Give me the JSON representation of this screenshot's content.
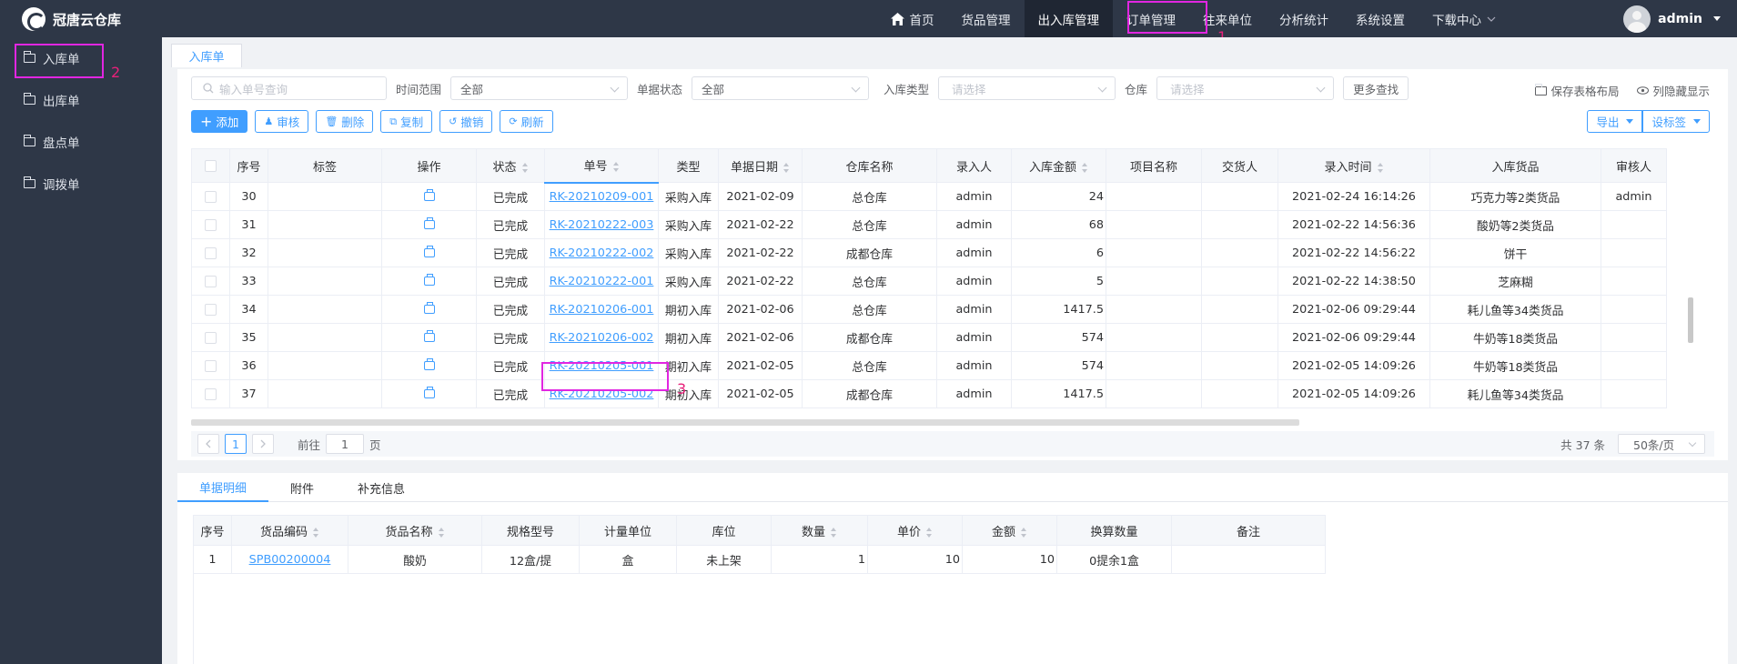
{
  "app": {
    "name": "冠唐云仓库"
  },
  "nav": {
    "items": [
      {
        "label": "首页"
      },
      {
        "label": "货品管理"
      },
      {
        "label": "出入库管理"
      },
      {
        "label": "订单管理"
      },
      {
        "label": "往来单位"
      },
      {
        "label": "分析统计"
      },
      {
        "label": "系统设置"
      },
      {
        "label": "下载中心"
      }
    ],
    "active": "出入库管理",
    "user": "admin"
  },
  "annotations": {
    "n1": "1",
    "n2": "2",
    "n3": "3",
    "color": "#e126e1"
  },
  "sidebar": {
    "items": [
      {
        "label": "入库单"
      },
      {
        "label": "出库单"
      },
      {
        "label": "盘点单"
      },
      {
        "label": "调拨单"
      }
    ]
  },
  "page_tab": "入库单",
  "filters": {
    "search_placeholder": "输入单号查询",
    "time_label": "时间范围",
    "time_value": "全部",
    "status_label": "单据状态",
    "status_value": "全部",
    "type_label": "入库类型",
    "type_placeholder": "请选择",
    "warehouse_label": "仓库",
    "warehouse_placeholder": "请选择",
    "more": "更多查找",
    "save_layout": "保存表格布局",
    "column_toggle": "列隐藏显示"
  },
  "toolbar": {
    "add": "添加",
    "audit": "审核",
    "delete": "删除",
    "copy": "复制",
    "revoke": "撤销",
    "refresh": "刷新",
    "export": "导出",
    "settings": "设标签"
  },
  "table": {
    "headers": [
      "序号",
      "标签",
      "操作",
      "状态",
      "单号",
      "类型",
      "单据日期",
      "仓库名称",
      "录入人",
      "入库金额",
      "项目名称",
      "交货人",
      "录入时间",
      "入库货品",
      "审核人"
    ],
    "rows": [
      {
        "no": "30",
        "status": "已完成",
        "code": "RK-20210209-001",
        "type": "采购入库",
        "date": "2021-02-09",
        "warehouse": "总仓库",
        "operator": "admin",
        "amount": "24",
        "time": "2021-02-24 16:14:26",
        "goods": "巧克力等2类货品",
        "auditor": "admin"
      },
      {
        "no": "31",
        "status": "已完成",
        "code": "RK-20210222-003",
        "type": "采购入库",
        "date": "2021-02-22",
        "warehouse": "总仓库",
        "operator": "admin",
        "amount": "68",
        "time": "2021-02-22 14:56:36",
        "goods": "酸奶等2类货品",
        "auditor": ""
      },
      {
        "no": "32",
        "status": "已完成",
        "code": "RK-20210222-002",
        "type": "采购入库",
        "date": "2021-02-22",
        "warehouse": "成都仓库",
        "operator": "admin",
        "amount": "6",
        "time": "2021-02-22 14:56:22",
        "goods": "饼干",
        "auditor": ""
      },
      {
        "no": "33",
        "status": "已完成",
        "code": "RK-20210222-001",
        "type": "采购入库",
        "date": "2021-02-22",
        "warehouse": "总仓库",
        "operator": "admin",
        "amount": "5",
        "time": "2021-02-22 14:38:50",
        "goods": "芝麻糊",
        "auditor": ""
      },
      {
        "no": "34",
        "status": "已完成",
        "code": "RK-20210206-001",
        "type": "期初入库",
        "date": "2021-02-06",
        "warehouse": "总仓库",
        "operator": "admin",
        "amount": "1417.5",
        "time": "2021-02-06 09:29:44",
        "goods": "耗儿鱼等34类货品",
        "auditor": ""
      },
      {
        "no": "35",
        "status": "已完成",
        "code": "RK-20210206-002",
        "type": "期初入库",
        "date": "2021-02-06",
        "warehouse": "成都仓库",
        "operator": "admin",
        "amount": "574",
        "time": "2021-02-06 09:29:44",
        "goods": "牛奶等18类货品",
        "auditor": ""
      },
      {
        "no": "36",
        "status": "已完成",
        "code": "RK-20210205-001",
        "type": "期初入库",
        "date": "2021-02-05",
        "warehouse": "总仓库",
        "operator": "admin",
        "amount": "574",
        "time": "2021-02-05 14:09:26",
        "goods": "牛奶等18类货品",
        "auditor": ""
      },
      {
        "no": "37",
        "status": "已完成",
        "code": "RK-20210205-002",
        "type": "期初入库",
        "date": "2021-02-05",
        "warehouse": "成都仓库",
        "operator": "admin",
        "amount": "1417.5",
        "time": "2021-02-05 14:09:26",
        "goods": "耗儿鱼等34类货品",
        "auditor": ""
      }
    ]
  },
  "pager": {
    "goto_prefix": "前往",
    "goto_value": "1",
    "goto_suffix": "页",
    "current": "1",
    "total": "共 37 条",
    "page_size": "50条/页"
  },
  "detail": {
    "tabs": [
      "单据明细",
      "附件",
      "补充信息"
    ],
    "headers": [
      "序号",
      "货品编码",
      "货品名称",
      "规格型号",
      "计量单位",
      "库位",
      "数量",
      "单价",
      "金额",
      "换算数量",
      "备注"
    ],
    "rows": [
      {
        "no": "1",
        "code": "SPB00200004",
        "name": "酸奶",
        "spec": "12盒/提",
        "unit": "盒",
        "location": "未上架",
        "qty": "1",
        "price": "10",
        "amount": "10",
        "convert": "0提余1盒",
        "remark": ""
      }
    ]
  }
}
